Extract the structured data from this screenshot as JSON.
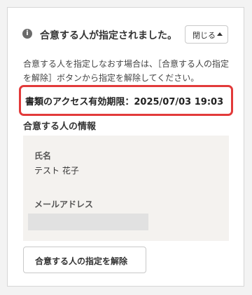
{
  "header": {
    "info_icon_glyph": "i",
    "message": "合意する人が指定されました。",
    "close_button_label": "閉じる",
    "close_icon": "caret-up-icon"
  },
  "description": "合意する人を指定しなおす場合は、［合意する人の指定を解除］ボタンから指定を解除してください。",
  "expiry": {
    "label": "書類のアクセス有効期限：",
    "value": "2025/07/03 19:03",
    "highlight_color": "#e23a3a"
  },
  "signer_section": {
    "title": "合意する人の情報",
    "name_label": "氏名",
    "name_value": "テスト 花子",
    "email_label": "メールアドレス"
  },
  "release_button_label": "合意する人の指定を解除"
}
